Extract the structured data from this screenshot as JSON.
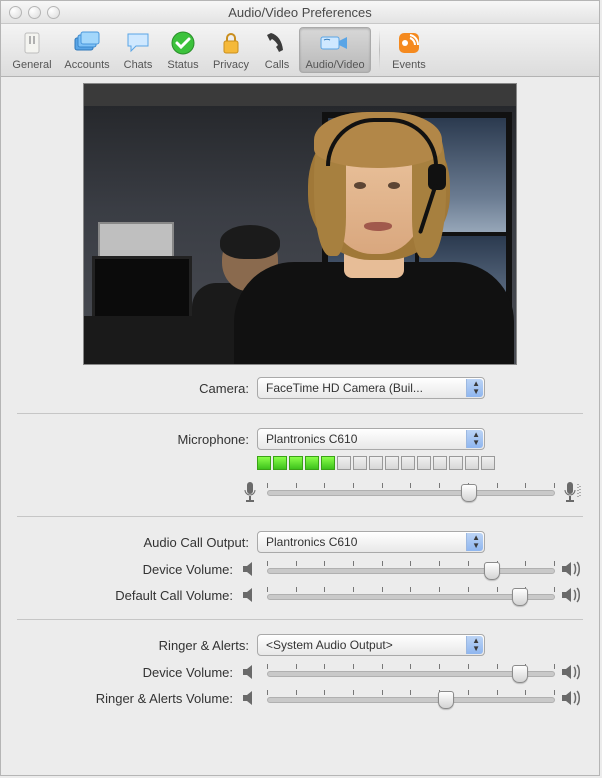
{
  "window": {
    "title": "Audio/Video Preferences"
  },
  "toolbar": {
    "items": [
      {
        "label": "General"
      },
      {
        "label": "Accounts"
      },
      {
        "label": "Chats"
      },
      {
        "label": "Status"
      },
      {
        "label": "Privacy"
      },
      {
        "label": "Calls"
      },
      {
        "label": "Audio/Video"
      },
      {
        "label": "Events"
      }
    ]
  },
  "camera": {
    "label": "Camera:",
    "value": "FaceTime HD Camera (Buil..."
  },
  "microphone": {
    "label": "Microphone:",
    "value": "Plantronics C610",
    "level": {
      "segments": 15,
      "lit": 5
    },
    "gain": {
      "value": 70
    }
  },
  "audio_output": {
    "label": "Audio Call Output:",
    "value": "Plantronics C610",
    "device_volume_label": "Device Volume:",
    "device_volume": 78,
    "default_call_volume_label": "Default Call Volume:",
    "default_call_volume": 88
  },
  "ringer": {
    "label": "Ringer & Alerts:",
    "value": "<System Audio Output>",
    "device_volume_label": "Device Volume:",
    "device_volume": 88,
    "alerts_volume_label": "Ringer & Alerts Volume:",
    "alerts_volume": 62
  }
}
